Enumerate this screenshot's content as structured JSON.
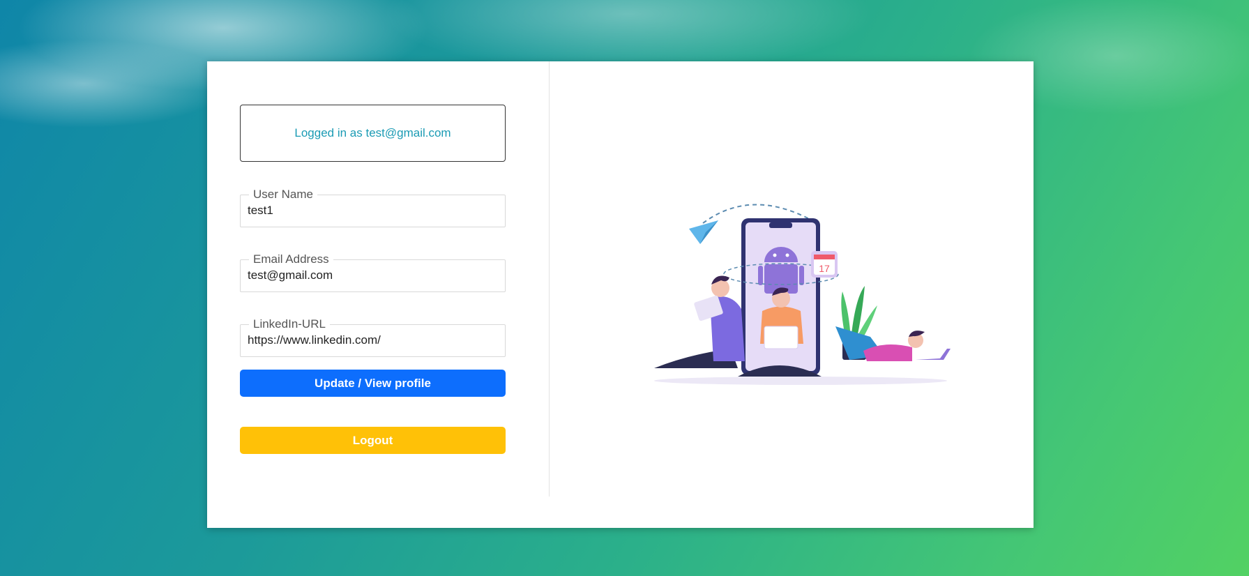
{
  "login_box": {
    "text": "Logged in as test@gmail.com"
  },
  "fields": {
    "username": {
      "label": "User Name",
      "value": "test1"
    },
    "email": {
      "label": "Email Address",
      "value": "test@gmail.com"
    },
    "linkedin": {
      "label": "LinkedIn-URL",
      "value": "https://www.linkedin.com/"
    }
  },
  "buttons": {
    "update": {
      "label": "Update / View profile"
    },
    "logout": {
      "label": "Logout"
    }
  },
  "illustration": {
    "calendar_day": "17"
  },
  "colors": {
    "primary": "#0d6efd",
    "warning": "#ffc107",
    "info_text": "#1b9bb4"
  }
}
